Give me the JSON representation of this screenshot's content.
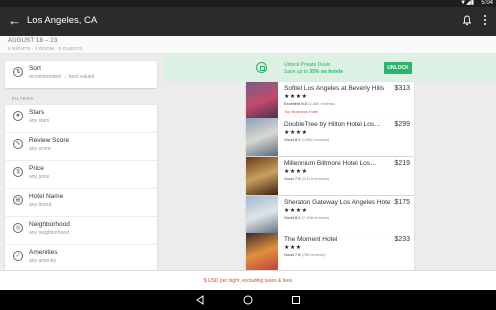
{
  "status_bar": {
    "icons": "▼◢▮",
    "time": "5:04"
  },
  "app_bar": {
    "back_glyph": "←",
    "title": "Los Angeles, CA"
  },
  "trip": {
    "dates": "AUGUST 18 – 23",
    "details": "5 NIGHTS · 1 ROOM · 2 GUESTS"
  },
  "sort": {
    "title": "Sort",
    "subtitle": "recommended → best valued"
  },
  "filters": {
    "header": "FILTERS",
    "items": [
      {
        "icon": "star-icon",
        "glyph": "★",
        "title": "Stars",
        "subtitle": "any stars"
      },
      {
        "icon": "review-icon",
        "glyph": "✎",
        "title": "Review Score",
        "subtitle": "any score"
      },
      {
        "icon": "price-icon",
        "glyph": "$",
        "title": "Price",
        "subtitle": "any price"
      },
      {
        "icon": "hotel-icon",
        "glyph": "▤",
        "title": "Hotel Name",
        "subtitle": "any brand"
      },
      {
        "icon": "location-icon",
        "glyph": "◎",
        "title": "Neighborhood",
        "subtitle": "any neighborhood"
      },
      {
        "icon": "amenities-icon",
        "glyph": "✓",
        "title": "Amenities",
        "subtitle": "any amenity"
      }
    ]
  },
  "deal": {
    "line1": "Unlock Private Deals",
    "line2_prefix": "Save up to ",
    "line2_highlight": "35% on hotels",
    "button": "UNLOCK"
  },
  "hotels": [
    {
      "name": "Sofitel Los Angeles at Beverly Hills",
      "price": "$313",
      "stars": "★★★★",
      "score": "Excellent 8.5",
      "reviews": "(2,085 reviews)",
      "tag": "Top Business Hotel",
      "photo_colors": [
        "#7a5c8a",
        "#c44a6b",
        "#3b3050"
      ]
    },
    {
      "name": "DoubleTree by Hilton Hotel Los…",
      "price": "$299",
      "stars": "★★★★",
      "score": "Good 8.0",
      "reviews": "(1,862 reviews)",
      "tag": "",
      "photo_colors": [
        "#8ea0b8",
        "#d8d8d0",
        "#5a6a7a"
      ]
    },
    {
      "name": "Millennium Biltmore Hotel Los…",
      "price": "$219",
      "stars": "★★★★",
      "score": "Good 7.5",
      "reviews": "(3,419 reviews)",
      "tag": "",
      "photo_colors": [
        "#6a3a1a",
        "#c8a060",
        "#3a2010"
      ]
    },
    {
      "name": "Sheraton Gateway Los Angeles Hotel",
      "price": "$175",
      "stars": "★★★★",
      "score": "Good 8.0",
      "reviews": "(7,458 reviews)",
      "tag": "",
      "photo_colors": [
        "#a0b8d0",
        "#e0e4e8",
        "#607080"
      ]
    },
    {
      "name": "The Moment Hotel",
      "price": "$233",
      "stars": "★★★",
      "score": "Good 7.8",
      "reviews": "(788 reviews)",
      "tag": "",
      "photo_colors": [
        "#3a2a2a",
        "#e0903a",
        "#c04040"
      ]
    }
  ],
  "footer_notice": "$ USD per night, excluding taxes & fees",
  "colors": {
    "accent": "#2db36a",
    "app_bar": "#2b2b2b",
    "warning": "#e0483a"
  }
}
